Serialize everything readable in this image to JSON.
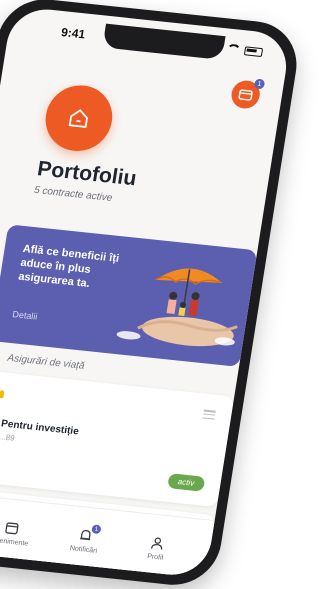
{
  "status_bar": {
    "time": "9:41"
  },
  "header": {
    "title": "Portofoliu",
    "subtitle": "5 contracte active",
    "wallet_badge": "1"
  },
  "promo": {
    "text": "Află ce beneficii îți aduce în plus asigurarea ta.",
    "link": "Detalii"
  },
  "section": {
    "label": "Asigurări de viață"
  },
  "cards": [
    {
      "name": "Pentru investiție",
      "number": "...89",
      "status": "activ"
    }
  ],
  "tabbar": {
    "items": [
      {
        "label": "Evenimente",
        "icon": "calendar-icon"
      },
      {
        "label": "Notificări",
        "icon": "bell-icon",
        "badge": "1"
      },
      {
        "label": "Profil",
        "icon": "profile-icon"
      }
    ]
  },
  "colors": {
    "accent": "#ee5a24",
    "promo_bg": "#5c5faf",
    "status_active": "#6aa84f"
  }
}
